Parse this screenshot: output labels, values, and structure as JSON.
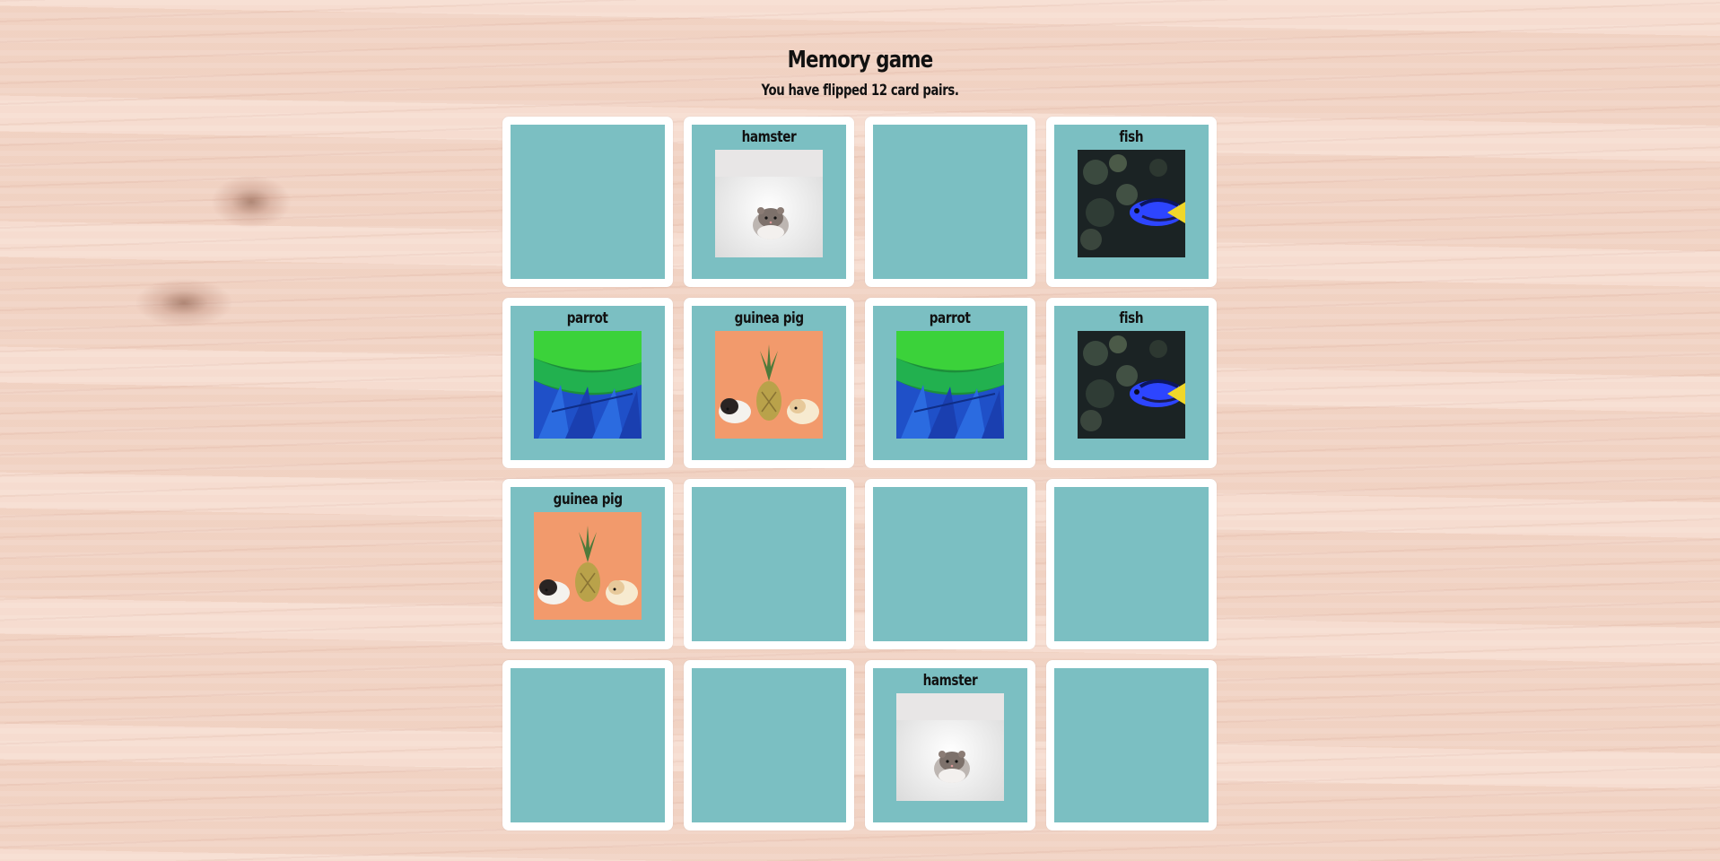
{
  "header": {
    "title": "Memory game",
    "status": "You have flipped 12 card pairs."
  },
  "cards": [
    {
      "flipped": false,
      "label": "",
      "icon": ""
    },
    {
      "flipped": true,
      "label": "hamster",
      "icon": "hamster-photo"
    },
    {
      "flipped": false,
      "label": "",
      "icon": ""
    },
    {
      "flipped": true,
      "label": "fish",
      "icon": "fish-photo"
    },
    {
      "flipped": true,
      "label": "parrot",
      "icon": "parrot-photo"
    },
    {
      "flipped": true,
      "label": "guinea pig",
      "icon": "guinea-pig-photo"
    },
    {
      "flipped": true,
      "label": "parrot",
      "icon": "parrot-photo"
    },
    {
      "flipped": true,
      "label": "fish",
      "icon": "fish-photo"
    },
    {
      "flipped": true,
      "label": "guinea pig",
      "icon": "guinea-pig-photo"
    },
    {
      "flipped": false,
      "label": "",
      "icon": ""
    },
    {
      "flipped": false,
      "label": "",
      "icon": ""
    },
    {
      "flipped": false,
      "label": "",
      "icon": ""
    },
    {
      "flipped": false,
      "label": "",
      "icon": ""
    },
    {
      "flipped": false,
      "label": "",
      "icon": ""
    },
    {
      "flipped": true,
      "label": "hamster",
      "icon": "hamster-photo"
    },
    {
      "flipped": false,
      "label": "",
      "icon": ""
    }
  ],
  "colors": {
    "card_face": "#7bbfc2",
    "card_border": "#ffffff",
    "table": "#f3d6c8"
  }
}
